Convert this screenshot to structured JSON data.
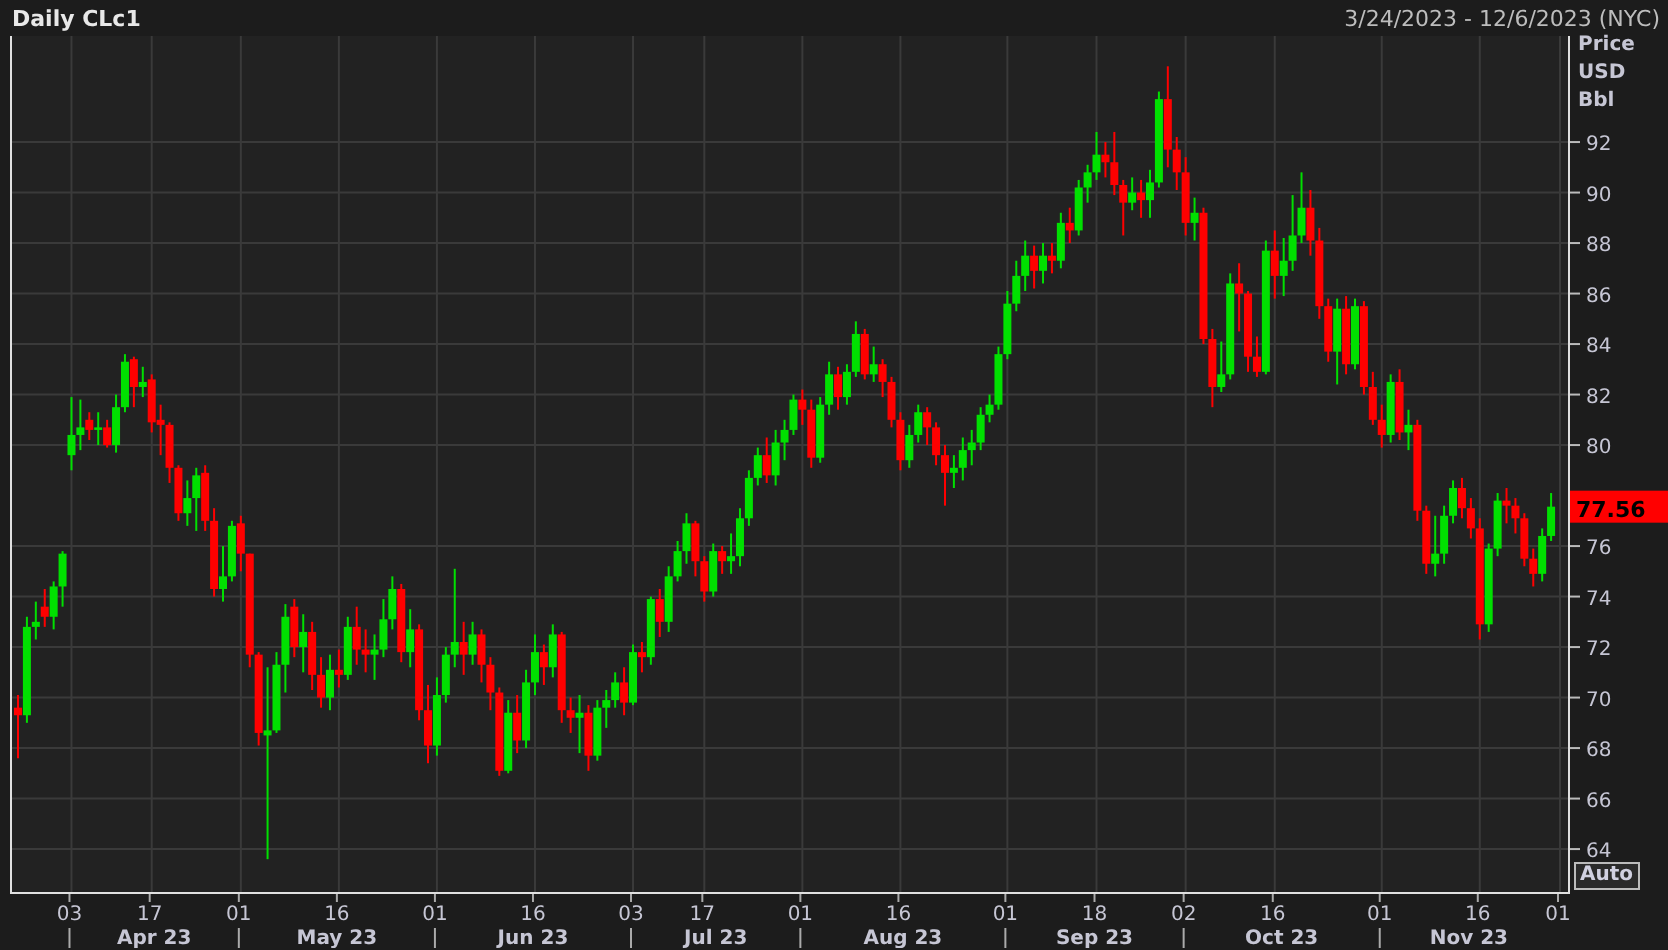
{
  "header": {
    "title": "Daily CLc1",
    "range": "3/24/2023 - 12/6/2023 (NYC)"
  },
  "chart": {
    "chart_data": {
      "type": "candlestick",
      "ylim": [
        62.3,
        96.2
      ],
      "yticks": [
        64,
        66,
        68,
        70,
        72,
        74,
        76,
        80,
        82,
        84,
        86,
        88,
        90,
        92
      ],
      "grid": true,
      "categories": [
        null,
        null,
        null,
        null,
        null,
        null,
        "03",
        null,
        null,
        null,
        null,
        null,
        null,
        null,
        null,
        "17",
        null,
        null,
        null,
        null,
        null,
        null,
        null,
        null,
        null,
        "01",
        null,
        null,
        null,
        null,
        null,
        null,
        null,
        null,
        null,
        null,
        "16",
        null,
        null,
        null,
        null,
        null,
        null,
        null,
        null,
        null,
        null,
        "01",
        null,
        null,
        null,
        null,
        null,
        null,
        null,
        null,
        null,
        null,
        "16",
        null,
        null,
        null,
        null,
        null,
        null,
        null,
        null,
        null,
        null,
        "03",
        null,
        null,
        null,
        null,
        null,
        null,
        null,
        "17",
        null,
        null,
        null,
        null,
        null,
        null,
        null,
        null,
        null,
        null,
        "01",
        null,
        null,
        null,
        null,
        null,
        null,
        null,
        null,
        null,
        null,
        "16",
        null,
        null,
        null,
        null,
        null,
        null,
        null,
        null,
        null,
        null,
        null,
        "01",
        null,
        null,
        null,
        null,
        null,
        null,
        null,
        null,
        null,
        "18",
        null,
        null,
        null,
        null,
        null,
        null,
        null,
        null,
        null,
        "02",
        null,
        null,
        null,
        null,
        null,
        null,
        null,
        null,
        null,
        "16",
        null,
        null,
        null,
        null,
        null,
        null,
        null,
        null,
        null,
        null,
        null,
        "01",
        null,
        null,
        null,
        null,
        null,
        null,
        null,
        null,
        null,
        null,
        "16",
        null,
        null,
        null,
        null,
        null,
        null,
        null,
        null,
        "01"
      ],
      "ohlc": [
        [
          69.6,
          70.1,
          67.6,
          69.3
        ],
        [
          69.3,
          73.2,
          69.0,
          72.8
        ],
        [
          72.8,
          73.8,
          72.3,
          73.0
        ],
        [
          73.6,
          74.3,
          72.8,
          73.2
        ],
        [
          73.2,
          74.6,
          72.7,
          74.4
        ],
        [
          74.4,
          75.8,
          73.6,
          75.7
        ],
        [
          79.6,
          81.9,
          79.0,
          80.4
        ],
        [
          80.4,
          81.8,
          79.8,
          80.7
        ],
        [
          81.0,
          81.3,
          80.2,
          80.6
        ],
        [
          80.6,
          81.3,
          80.0,
          80.7
        ],
        [
          80.7,
          81.0,
          79.9,
          80.0
        ],
        [
          80.0,
          82.0,
          79.7,
          81.5
        ],
        [
          81.5,
          83.6,
          81.3,
          83.3
        ],
        [
          83.4,
          83.5,
          81.5,
          82.3
        ],
        [
          82.3,
          83.1,
          81.9,
          82.5
        ],
        [
          82.6,
          82.8,
          80.5,
          80.9
        ],
        [
          81.0,
          81.6,
          79.6,
          80.8
        ],
        [
          80.8,
          80.9,
          78.5,
          79.1
        ],
        [
          79.1,
          79.2,
          77.0,
          77.3
        ],
        [
          77.3,
          78.6,
          76.8,
          77.9
        ],
        [
          77.9,
          79.1,
          76.6,
          78.8
        ],
        [
          78.9,
          79.2,
          76.6,
          77.0
        ],
        [
          77.0,
          77.5,
          74.0,
          74.3
        ],
        [
          74.3,
          76.0,
          73.8,
          74.8
        ],
        [
          74.8,
          77.0,
          74.6,
          76.8
        ],
        [
          76.9,
          77.2,
          75.0,
          75.7
        ],
        [
          75.7,
          75.7,
          71.2,
          71.7
        ],
        [
          71.7,
          71.8,
          68.1,
          68.6
        ],
        [
          68.5,
          71.2,
          63.6,
          68.7
        ],
        [
          68.7,
          71.8,
          68.6,
          71.3
        ],
        [
          71.3,
          73.7,
          70.2,
          73.2
        ],
        [
          73.6,
          73.9,
          71.6,
          72.0
        ],
        [
          72.0,
          73.3,
          71.0,
          72.6
        ],
        [
          72.6,
          73.0,
          70.3,
          70.9
        ],
        [
          70.9,
          71.6,
          69.6,
          70.0
        ],
        [
          70.0,
          71.7,
          69.5,
          71.1
        ],
        [
          71.1,
          71.9,
          70.4,
          70.9
        ],
        [
          70.9,
          73.2,
          70.7,
          72.8
        ],
        [
          72.8,
          73.6,
          71.3,
          71.9
        ],
        [
          71.9,
          72.7,
          71.0,
          71.7
        ],
        [
          71.7,
          72.5,
          70.7,
          71.9
        ],
        [
          71.9,
          73.9,
          71.6,
          73.1
        ],
        [
          73.1,
          74.8,
          72.7,
          74.3
        ],
        [
          74.3,
          74.5,
          71.4,
          71.8
        ],
        [
          71.8,
          73.5,
          71.2,
          72.7
        ],
        [
          72.7,
          72.9,
          69.1,
          69.5
        ],
        [
          69.5,
          70.5,
          67.4,
          68.1
        ],
        [
          68.1,
          70.8,
          67.7,
          70.1
        ],
        [
          70.1,
          72.0,
          69.8,
          71.7
        ],
        [
          71.7,
          75.1,
          71.2,
          72.2
        ],
        [
          72.2,
          73.0,
          70.9,
          71.7
        ],
        [
          71.7,
          73.0,
          71.3,
          72.5
        ],
        [
          72.5,
          72.7,
          70.6,
          71.3
        ],
        [
          71.3,
          71.6,
          69.5,
          70.2
        ],
        [
          70.2,
          70.4,
          66.9,
          67.1
        ],
        [
          67.1,
          69.9,
          67.0,
          69.4
        ],
        [
          69.4,
          70.1,
          67.8,
          68.3
        ],
        [
          68.3,
          71.1,
          68.0,
          70.6
        ],
        [
          70.6,
          72.5,
          70.1,
          71.8
        ],
        [
          71.8,
          72.1,
          70.5,
          71.2
        ],
        [
          71.2,
          72.9,
          70.8,
          72.5
        ],
        [
          72.5,
          72.6,
          69.0,
          69.5
        ],
        [
          69.5,
          70.0,
          68.6,
          69.2
        ],
        [
          69.2,
          70.1,
          67.8,
          69.4
        ],
        [
          69.4,
          69.7,
          67.1,
          67.7
        ],
        [
          67.7,
          69.9,
          67.5,
          69.6
        ],
        [
          69.6,
          70.3,
          68.8,
          69.9
        ],
        [
          69.9,
          71.0,
          69.6,
          70.6
        ],
        [
          70.6,
          71.2,
          69.3,
          69.8
        ],
        [
          69.8,
          72.1,
          69.7,
          71.8
        ],
        [
          71.8,
          72.2,
          71.0,
          71.6
        ],
        [
          71.6,
          74.0,
          71.3,
          73.9
        ],
        [
          73.9,
          74.3,
          72.4,
          73.0
        ],
        [
          73.0,
          75.2,
          72.6,
          74.8
        ],
        [
          74.8,
          76.2,
          74.6,
          75.8
        ],
        [
          75.8,
          77.3,
          75.3,
          76.9
        ],
        [
          76.9,
          77.0,
          74.8,
          75.4
        ],
        [
          75.4,
          75.6,
          73.8,
          74.2
        ],
        [
          74.2,
          76.1,
          74.0,
          75.8
        ],
        [
          75.8,
          76.0,
          74.9,
          75.4
        ],
        [
          75.4,
          76.5,
          74.9,
          75.6
        ],
        [
          75.6,
          77.5,
          75.2,
          77.1
        ],
        [
          77.1,
          79.0,
          76.8,
          78.7
        ],
        [
          78.7,
          79.9,
          78.4,
          79.6
        ],
        [
          79.6,
          80.3,
          78.5,
          78.8
        ],
        [
          78.8,
          80.6,
          78.4,
          80.1
        ],
        [
          80.1,
          81.0,
          79.4,
          80.6
        ],
        [
          80.6,
          82.0,
          80.4,
          81.8
        ],
        [
          81.8,
          82.2,
          80.8,
          81.4
        ],
        [
          81.4,
          81.8,
          79.1,
          79.5
        ],
        [
          79.5,
          81.9,
          79.3,
          81.6
        ],
        [
          81.6,
          83.3,
          81.2,
          82.8
        ],
        [
          82.8,
          83.1,
          81.4,
          81.9
        ],
        [
          81.9,
          83.2,
          81.6,
          82.9
        ],
        [
          82.9,
          84.9,
          82.7,
          84.4
        ],
        [
          84.4,
          84.6,
          82.6,
          82.8
        ],
        [
          82.8,
          83.9,
          82.5,
          83.2
        ],
        [
          83.2,
          83.4,
          81.9,
          82.5
        ],
        [
          82.5,
          82.7,
          80.7,
          81.0
        ],
        [
          81.0,
          81.3,
          79.0,
          79.4
        ],
        [
          79.4,
          80.8,
          79.1,
          80.4
        ],
        [
          80.4,
          81.6,
          80.1,
          81.3
        ],
        [
          81.3,
          81.5,
          80.0,
          80.7
        ],
        [
          80.7,
          80.9,
          79.2,
          79.6
        ],
        [
          79.6,
          80.0,
          77.6,
          78.9
        ],
        [
          78.9,
          79.6,
          78.3,
          79.1
        ],
        [
          79.1,
          80.3,
          78.6,
          79.8
        ],
        [
          79.8,
          80.6,
          79.2,
          80.1
        ],
        [
          80.1,
          81.5,
          79.8,
          81.2
        ],
        [
          81.2,
          82.0,
          80.9,
          81.6
        ],
        [
          81.6,
          83.9,
          81.4,
          83.6
        ],
        [
          83.6,
          86.1,
          83.4,
          85.6
        ],
        [
          85.6,
          87.3,
          85.3,
          86.7
        ],
        [
          86.7,
          88.1,
          86.1,
          87.5
        ],
        [
          87.5,
          87.9,
          86.2,
          86.9
        ],
        [
          86.9,
          88.0,
          86.4,
          87.5
        ],
        [
          87.5,
          88.0,
          86.8,
          87.3
        ],
        [
          87.3,
          89.2,
          87.0,
          88.8
        ],
        [
          88.8,
          89.4,
          88.0,
          88.5
        ],
        [
          88.5,
          90.5,
          88.3,
          90.2
        ],
        [
          90.2,
          91.1,
          89.6,
          90.8
        ],
        [
          90.8,
          92.4,
          90.5,
          91.5
        ],
        [
          91.5,
          92.0,
          90.6,
          91.2
        ],
        [
          91.2,
          92.4,
          89.9,
          90.3
        ],
        [
          90.3,
          90.5,
          88.3,
          89.6
        ],
        [
          89.6,
          90.6,
          89.3,
          90.0
        ],
        [
          90.0,
          90.5,
          89.0,
          89.7
        ],
        [
          89.7,
          90.9,
          89.0,
          90.4
        ],
        [
          90.4,
          94.0,
          90.2,
          93.7
        ],
        [
          93.7,
          95.0,
          91.0,
          91.7
        ],
        [
          91.7,
          92.2,
          90.1,
          90.8
        ],
        [
          90.8,
          91.4,
          88.3,
          88.8
        ],
        [
          88.8,
          89.8,
          88.1,
          89.2
        ],
        [
          89.2,
          89.4,
          84.0,
          84.2
        ],
        [
          84.2,
          84.6,
          81.5,
          82.3
        ],
        [
          82.3,
          84.1,
          82.1,
          82.8
        ],
        [
          82.8,
          86.8,
          82.6,
          86.4
        ],
        [
          86.4,
          87.2,
          84.5,
          86.0
        ],
        [
          86.0,
          86.1,
          82.9,
          83.5
        ],
        [
          83.5,
          84.3,
          82.7,
          82.9
        ],
        [
          82.9,
          88.1,
          82.8,
          87.7
        ],
        [
          87.7,
          88.5,
          85.8,
          86.7
        ],
        [
          86.7,
          88.2,
          85.9,
          87.3
        ],
        [
          87.3,
          89.9,
          86.9,
          88.3
        ],
        [
          88.3,
          90.8,
          88.0,
          89.4
        ],
        [
          89.4,
          90.1,
          87.5,
          88.1
        ],
        [
          88.1,
          88.6,
          85.0,
          85.5
        ],
        [
          85.5,
          85.8,
          83.3,
          83.7
        ],
        [
          83.7,
          85.8,
          82.4,
          85.4
        ],
        [
          85.4,
          85.9,
          82.8,
          83.2
        ],
        [
          83.2,
          85.8,
          83.0,
          85.5
        ],
        [
          85.5,
          85.7,
          82.0,
          82.3
        ],
        [
          82.3,
          82.9,
          80.8,
          81.0
        ],
        [
          81.0,
          81.6,
          79.9,
          80.4
        ],
        [
          80.4,
          82.8,
          80.1,
          82.5
        ],
        [
          82.5,
          83.0,
          80.2,
          80.5
        ],
        [
          80.5,
          81.4,
          79.8,
          80.8
        ],
        [
          80.8,
          81.0,
          77.0,
          77.4
        ],
        [
          77.4,
          77.6,
          74.9,
          75.3
        ],
        [
          75.3,
          77.2,
          74.8,
          75.7
        ],
        [
          75.7,
          77.6,
          75.3,
          77.2
        ],
        [
          77.2,
          78.6,
          76.9,
          78.3
        ],
        [
          78.3,
          78.7,
          77.1,
          77.5
        ],
        [
          77.5,
          77.9,
          76.3,
          76.7
        ],
        [
          76.7,
          77.1,
          72.3,
          72.9
        ],
        [
          72.9,
          76.1,
          72.6,
          75.9
        ],
        [
          75.9,
          78.1,
          75.6,
          77.8
        ],
        [
          77.8,
          78.3,
          76.9,
          77.6
        ],
        [
          77.6,
          77.9,
          76.5,
          77.1
        ],
        [
          77.1,
          77.3,
          75.2,
          75.5
        ],
        [
          75.5,
          75.9,
          74.4,
          74.9
        ],
        [
          74.9,
          76.7,
          74.6,
          76.4
        ],
        [
          76.4,
          78.1,
          76.2,
          77.56
        ],
        null
      ]
    },
    "months": [
      {
        "label": "Apr 23"
      },
      {
        "label": "May 23"
      },
      {
        "label": "Jun 23"
      },
      {
        "label": "Jul 23"
      },
      {
        "label": "Aug 23"
      },
      {
        "label": "Sep 23"
      },
      {
        "label": "Oct 23"
      },
      {
        "label": "Nov 23"
      }
    ]
  },
  "axis": {
    "units": [
      "Price",
      "USD",
      "Bbl"
    ],
    "last_price": "77.56",
    "auto_button": "Auto"
  }
}
